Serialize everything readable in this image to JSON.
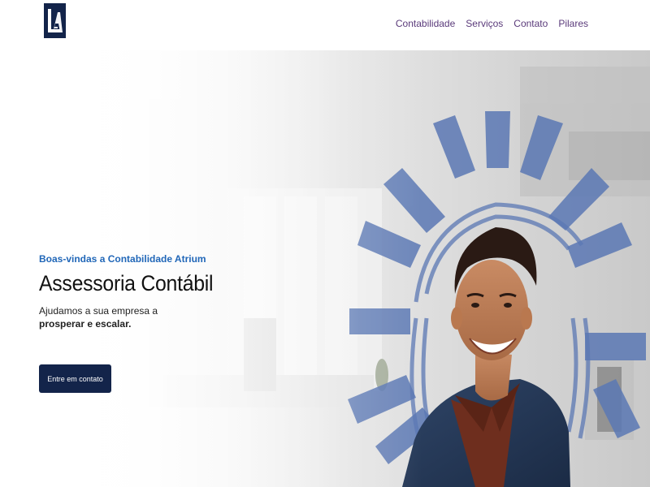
{
  "header": {
    "logo_letters": "LA",
    "nav": [
      {
        "label": "Contabilidade"
      },
      {
        "label": "Serviços"
      },
      {
        "label": "Contato"
      },
      {
        "label": "Pilares"
      }
    ]
  },
  "hero": {
    "welcome": "Boas-vindas a Contabilidade Atrium",
    "title": "Assessoria Contábil",
    "desc_line1": "Ajudamos a sua empresa a",
    "desc_line2": "prosperar e escalar.",
    "cta_label": "Entre em contato"
  },
  "colors": {
    "brand_navy": "#13244a",
    "nav_text": "#5a3a7a",
    "accent_blue": "#2167b8",
    "sunburst": "#5b78b4"
  }
}
